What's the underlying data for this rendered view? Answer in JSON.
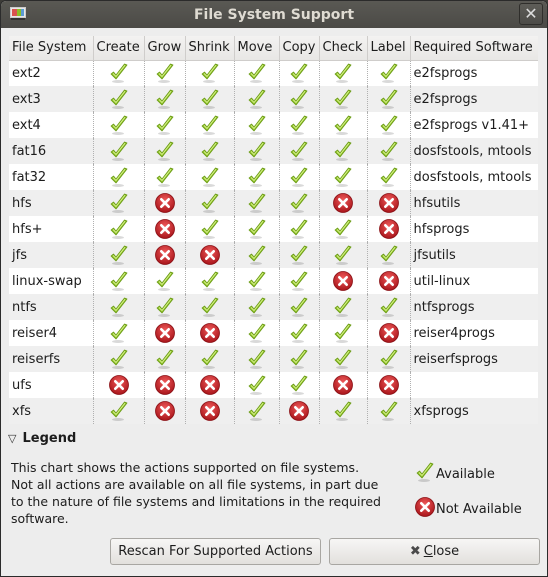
{
  "window": {
    "title": "File System Support",
    "app_icon": "gparted-icon",
    "close_icon": "close-icon"
  },
  "table": {
    "columns": [
      "File System",
      "Create",
      "Grow",
      "Shrink",
      "Move",
      "Copy",
      "Check",
      "Label",
      "Required Software"
    ],
    "action_columns": [
      "Create",
      "Grow",
      "Shrink",
      "Move",
      "Copy",
      "Check",
      "Label"
    ],
    "rows": [
      {
        "fs": "ext2",
        "support": [
          true,
          true,
          true,
          true,
          true,
          true,
          true
        ],
        "software": "e2fsprogs"
      },
      {
        "fs": "ext3",
        "support": [
          true,
          true,
          true,
          true,
          true,
          true,
          true
        ],
        "software": "e2fsprogs"
      },
      {
        "fs": "ext4",
        "support": [
          true,
          true,
          true,
          true,
          true,
          true,
          true
        ],
        "software": "e2fsprogs v1.41+"
      },
      {
        "fs": "fat16",
        "support": [
          true,
          true,
          true,
          true,
          true,
          true,
          true
        ],
        "software": "dosfstools, mtools"
      },
      {
        "fs": "fat32",
        "support": [
          true,
          true,
          true,
          true,
          true,
          true,
          true
        ],
        "software": "dosfstools, mtools"
      },
      {
        "fs": "hfs",
        "support": [
          true,
          false,
          true,
          true,
          true,
          false,
          false
        ],
        "software": "hfsutils"
      },
      {
        "fs": "hfs+",
        "support": [
          true,
          false,
          true,
          true,
          true,
          true,
          false
        ],
        "software": "hfsprogs"
      },
      {
        "fs": "jfs",
        "support": [
          true,
          false,
          false,
          true,
          true,
          true,
          true
        ],
        "software": "jfsutils"
      },
      {
        "fs": "linux-swap",
        "support": [
          true,
          true,
          true,
          true,
          true,
          false,
          false
        ],
        "software": "util-linux"
      },
      {
        "fs": "ntfs",
        "support": [
          true,
          true,
          true,
          true,
          true,
          true,
          true
        ],
        "software": "ntfsprogs"
      },
      {
        "fs": "reiser4",
        "support": [
          true,
          false,
          false,
          true,
          true,
          true,
          false
        ],
        "software": "reiser4progs"
      },
      {
        "fs": "reiserfs",
        "support": [
          true,
          true,
          true,
          true,
          true,
          true,
          true
        ],
        "software": "reiserfsprogs"
      },
      {
        "fs": "ufs",
        "support": [
          false,
          false,
          false,
          true,
          true,
          false,
          false
        ],
        "software": ""
      },
      {
        "fs": "xfs",
        "support": [
          true,
          false,
          false,
          true,
          false,
          true,
          true
        ],
        "software": "xfsprogs"
      }
    ]
  },
  "legend": {
    "title": "Legend",
    "expander_icon": "triangle-down-icon",
    "description": "This chart shows the actions supported on file systems. Not all actions are available on all file systems, in part due to the nature of file systems and limitations in the required software.",
    "available_label": "Available",
    "not_available_label": "Not Available"
  },
  "buttons": {
    "rescan_label": "Rescan For Supported Actions",
    "close_label_mnemonic": "C",
    "close_label_rest": "lose"
  },
  "colors": {
    "check_green": "#8cbf26",
    "cross_red": "#c8232a",
    "titlebar": "#4f4e4a"
  }
}
